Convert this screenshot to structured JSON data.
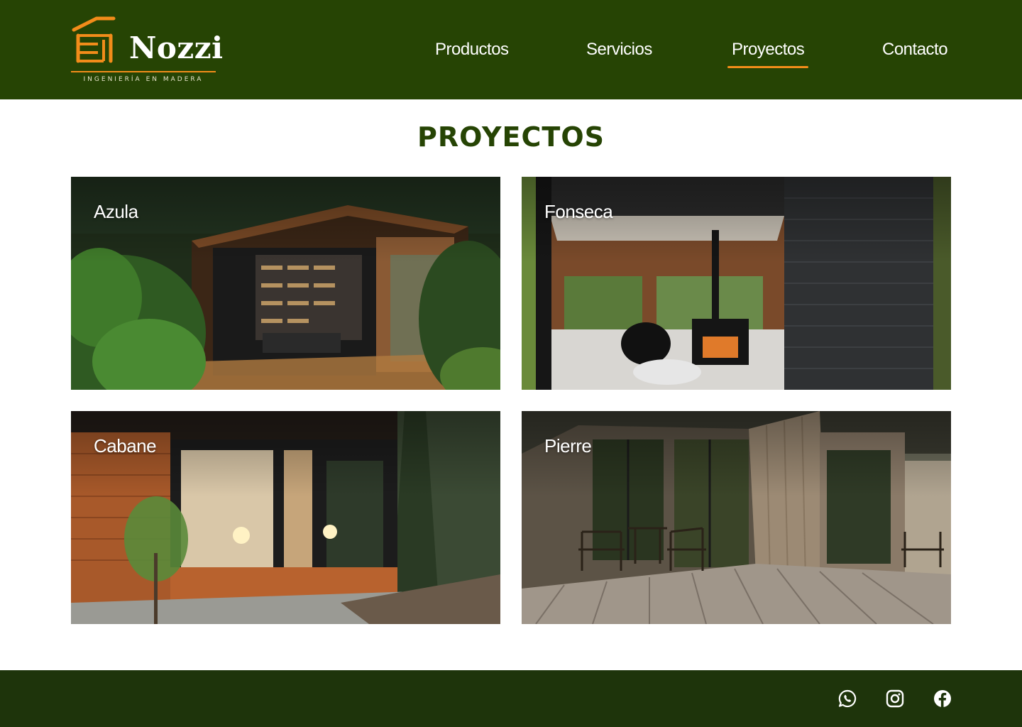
{
  "brand": {
    "name": "Nozzi",
    "tagline": "INGENIERÍA EN MADERA",
    "accent_color": "#f28c1a",
    "primary_color": "#264404"
  },
  "nav": {
    "items": [
      {
        "label": "Productos",
        "active": false
      },
      {
        "label": "Servicios",
        "active": false
      },
      {
        "label": "Proyectos",
        "active": true
      },
      {
        "label": "Contacto",
        "active": false
      }
    ]
  },
  "main": {
    "title": "PROYECTOS",
    "projects": [
      {
        "name": "Azula",
        "image": "glass-corner-cabin-library"
      },
      {
        "name": "Fonseca",
        "image": "dark-cabin-wood-stove"
      },
      {
        "name": "Cabane",
        "image": "cedar-cabin-forest-night"
      },
      {
        "name": "Pierre",
        "image": "wooden-deck-pine-forest"
      }
    ]
  },
  "footer": {
    "social": [
      {
        "icon": "whatsapp-icon"
      },
      {
        "icon": "instagram-icon"
      },
      {
        "icon": "facebook-icon"
      }
    ]
  }
}
